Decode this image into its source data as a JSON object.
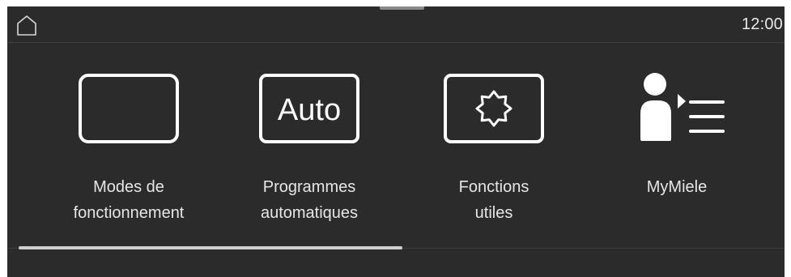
{
  "status_bar": {
    "clock": "12:00"
  },
  "menu": {
    "items": [
      {
        "line1": "Modes de",
        "line2": "fonctionnement"
      },
      {
        "line1": "Programmes",
        "line2": "automatiques",
        "icon_text": "Auto"
      },
      {
        "line1": "Fonctions",
        "line2": "utiles"
      },
      {
        "line1": "MyMiele",
        "line2": ""
      }
    ]
  },
  "colors": {
    "background": "#2b2b2b",
    "foreground": "#ffffff",
    "text": "#e6e6e6"
  },
  "icons": [
    "home-icon",
    "operating-modes-icon",
    "auto-programs-icon",
    "useful-functions-icon",
    "mymiele-icon"
  ]
}
